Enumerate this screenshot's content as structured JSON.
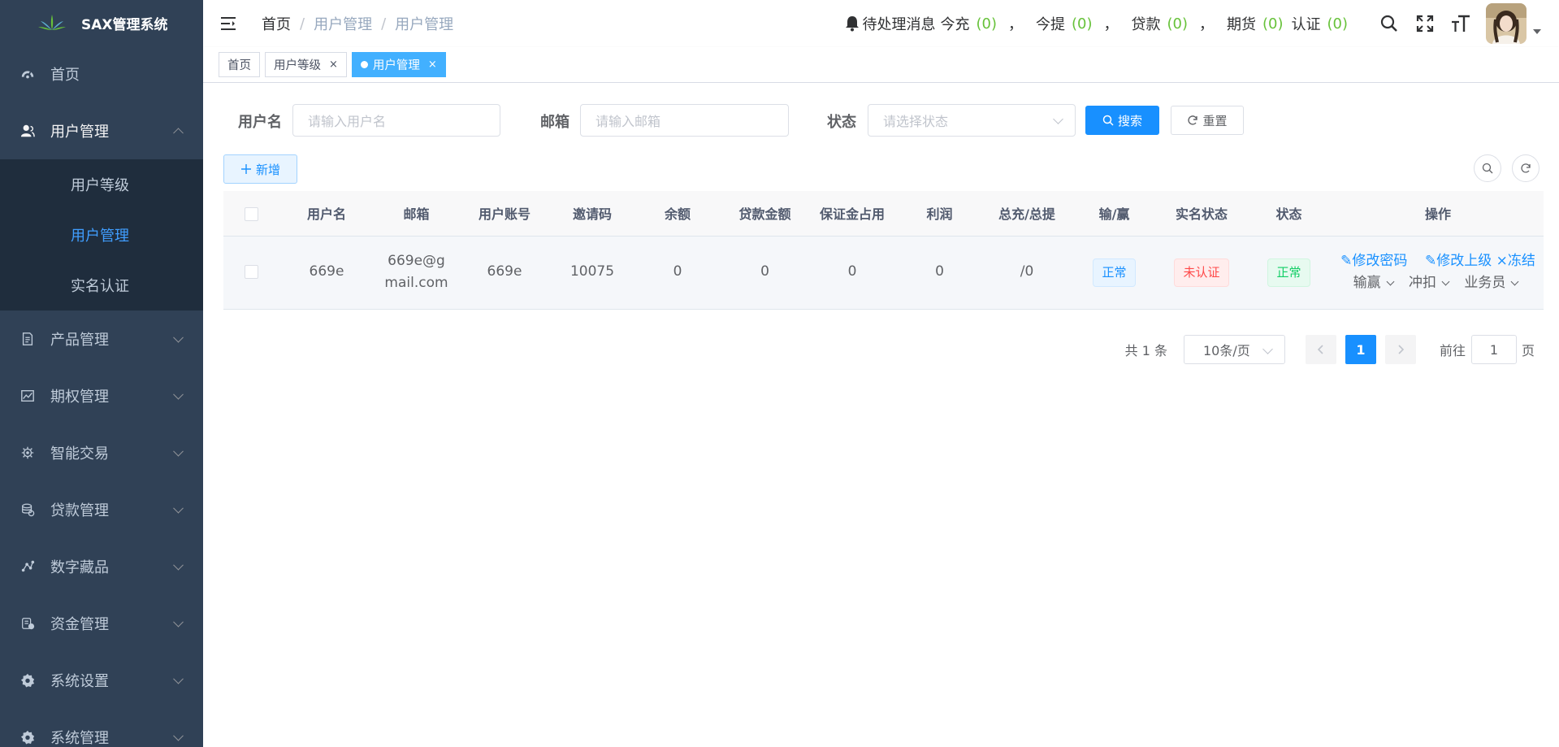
{
  "sidebar": {
    "logo_text": "SAX管理系统",
    "menu": [
      {
        "label": "首页",
        "icon": "dashboard-icon"
      },
      {
        "label": "用户管理",
        "icon": "user-icon",
        "children": [
          "用户等级",
          "用户管理",
          "实名认证"
        ]
      },
      {
        "label": "产品管理",
        "icon": "document-icon"
      },
      {
        "label": "期权管理",
        "icon": "chart-icon"
      },
      {
        "label": "智能交易",
        "icon": "gear-small-icon"
      },
      {
        "label": "贷款管理",
        "icon": "coins-icon"
      },
      {
        "label": "数字藏品",
        "icon": "network-icon"
      },
      {
        "label": "资金管理",
        "icon": "money-icon"
      },
      {
        "label": "系统设置",
        "icon": "settings-icon"
      },
      {
        "label": "系统管理",
        "icon": "settings-icon"
      }
    ]
  },
  "navbar": {
    "breadcrumb": [
      "首页",
      "用户管理",
      "用户管理"
    ],
    "notify_label": "待处理消息",
    "counters": [
      {
        "label": "今充",
        "value": "(0)"
      },
      {
        "label": "今提",
        "value": "(0)"
      },
      {
        "label": "贷款",
        "value": "(0)"
      },
      {
        "label": "期货",
        "value": "(0)"
      },
      {
        "label": "认证",
        "value": "(0)"
      }
    ],
    "comma": "，"
  },
  "tags": [
    {
      "label": "首页",
      "closable": false
    },
    {
      "label": "用户等级",
      "closable": true
    },
    {
      "label": "用户管理",
      "closable": true,
      "active": true
    }
  ],
  "tag_close": "×",
  "search": {
    "username_label": "用户名",
    "username_placeholder": "请输入用户名",
    "email_label": "邮箱",
    "email_placeholder": "请输入邮箱",
    "status_label": "状态",
    "status_placeholder": "请选择状态",
    "search_button": "搜索",
    "reset_button": "重置",
    "add_button": "新增"
  },
  "table": {
    "headers": [
      "用户名",
      "邮箱",
      "用户账号",
      "邀请码",
      "余额",
      "贷款金额",
      "保证金占用",
      "利润",
      "总充/总提",
      "输/赢",
      "实名状态",
      "状态",
      "操作"
    ],
    "rows": [
      {
        "username": "669e",
        "email": "669e@gmail.com",
        "account": "669e",
        "invite_code": "10075",
        "balance": "0",
        "loan_amount": "0",
        "margin": "0",
        "profit": "0",
        "recharge_withdraw": "/0",
        "win_lose": "正常",
        "realname_status": "未认证",
        "status": "正常"
      }
    ],
    "ops": {
      "change_password": "修改密码",
      "change_superior": "修改上级",
      "freeze": "冻结",
      "win_lose_dd": "输赢",
      "offset_dd": "冲扣",
      "salesman_dd": "业务员"
    }
  },
  "pagination": {
    "total": "共 1 条",
    "page_size": "10条/页",
    "current": "1",
    "goto_label": "前往",
    "goto_value": "1",
    "page_suffix": "页"
  },
  "colors": {
    "sidebar_bg": "#304156",
    "submenu_bg": "#1f2d3d",
    "primary": "#1890ff",
    "success": "#13ce66",
    "danger": "#ff4949",
    "counter": "#67c23a"
  }
}
